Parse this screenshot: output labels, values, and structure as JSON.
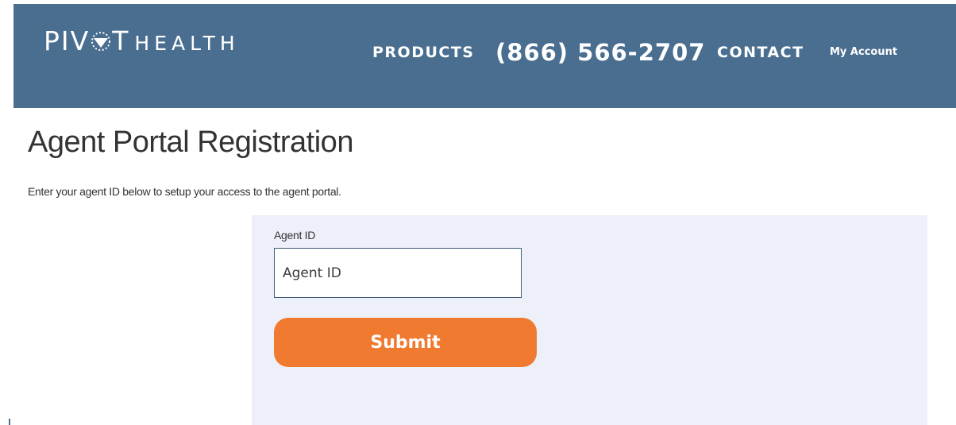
{
  "header": {
    "logo_pivot_left": "PIV",
    "logo_pivot_right": "T",
    "logo_health": "HEALTH",
    "logo_mark_icon": "pivot-circle-icon",
    "background_color": "#4a6e90",
    "nav": {
      "products": "PRODUCTS",
      "phone": "(866) 566-2707",
      "contact": "CONTACT",
      "my_account": "My Account"
    }
  },
  "main": {
    "title": "Agent Portal Registration",
    "intro": "Enter your agent ID below to setup your access to the agent portal.",
    "form": {
      "panel_color": "#eef0f9",
      "agent_id_label": "Agent ID",
      "agent_id_value": "",
      "agent_id_placeholder": "Agent ID",
      "submit_label": "Submit",
      "submit_color": "#f07a2f"
    }
  }
}
